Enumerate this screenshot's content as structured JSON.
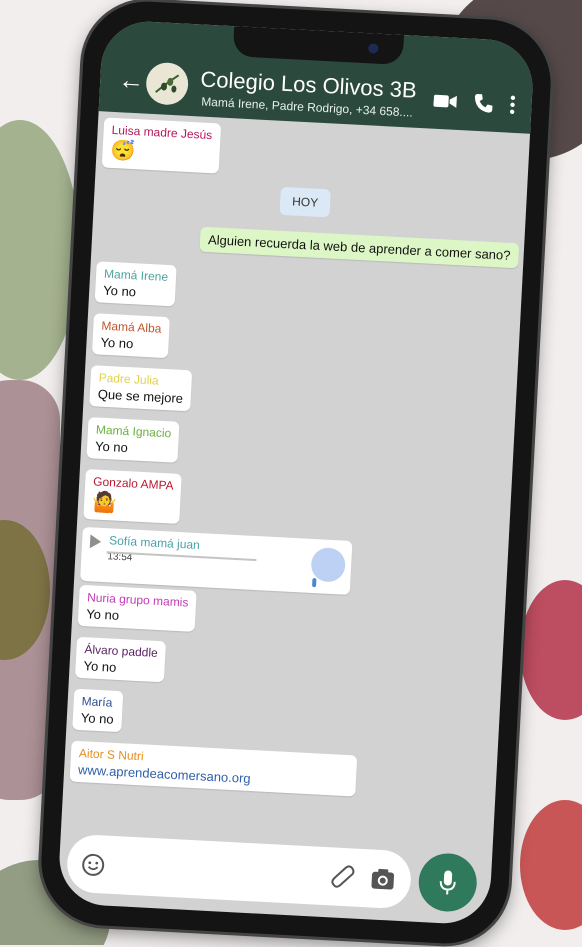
{
  "header": {
    "title": "Colegio Los Olivos 3B",
    "subtitle": "Mamá Irene, Padre Rodrigo, +34 658...."
  },
  "day_label": "HOY",
  "messages": [
    {
      "sender": "Luisa madre Jesús",
      "text": "😴",
      "color": "#b5165d"
    },
    {
      "sender": "",
      "text": "Alguien recuerda la web de aprender a comer sano?",
      "outgoing": true
    },
    {
      "sender": "Mamá Irene",
      "text": "Yo no",
      "color": "#4fa3a1"
    },
    {
      "sender": "Mamá Alba",
      "text": "Yo no",
      "color": "#c0552a"
    },
    {
      "sender": "Padre Julia",
      "text": "Que se mejore",
      "color": "#e2d24a"
    },
    {
      "sender": "Mamá Ignacio",
      "text": "Yo no",
      "color": "#69b13c"
    },
    {
      "sender": "Gonzalo AMPA",
      "text": "🤷",
      "color": "#b71b32"
    },
    {
      "sender": "Sofía mamá juan",
      "duration": "13:54",
      "color": "#4aa1a6"
    },
    {
      "sender": "Nuria grupo mamis",
      "text": "Yo no",
      "color": "#c23bb5"
    },
    {
      "sender": "Álvaro paddle",
      "text": "Yo no",
      "color": "#5a1f63"
    },
    {
      "sender": "María",
      "text": "Yo no",
      "color": "#2b4f8f"
    },
    {
      "sender": "Aitor S Nutri",
      "text": "www.aprendeacomersano.org",
      "color": "#e38f1f"
    }
  ],
  "icons": [
    "back-arrow-icon",
    "video-call-icon",
    "phone-icon",
    "more-vert-icon",
    "emoji-icon",
    "attach-icon",
    "camera-icon",
    "mic-icon",
    "play-icon"
  ]
}
